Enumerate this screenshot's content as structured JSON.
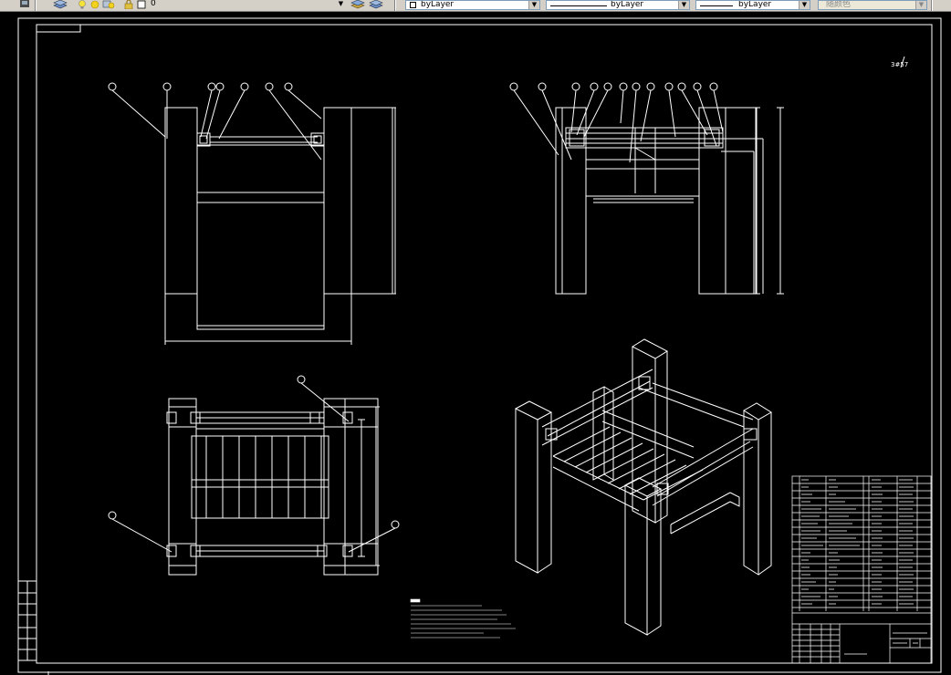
{
  "toolbar": {
    "layer_current": "0",
    "color_value": "byLayer",
    "linetype_value": "byLayer",
    "lineweight_value": "byLayer",
    "plotstyle_value": "随颜色"
  },
  "drawing": {
    "sheet_label": "3#57"
  },
  "colors": {
    "background": "#000000",
    "lines": "#ffffff",
    "toolbar": "#d4d0c8"
  }
}
